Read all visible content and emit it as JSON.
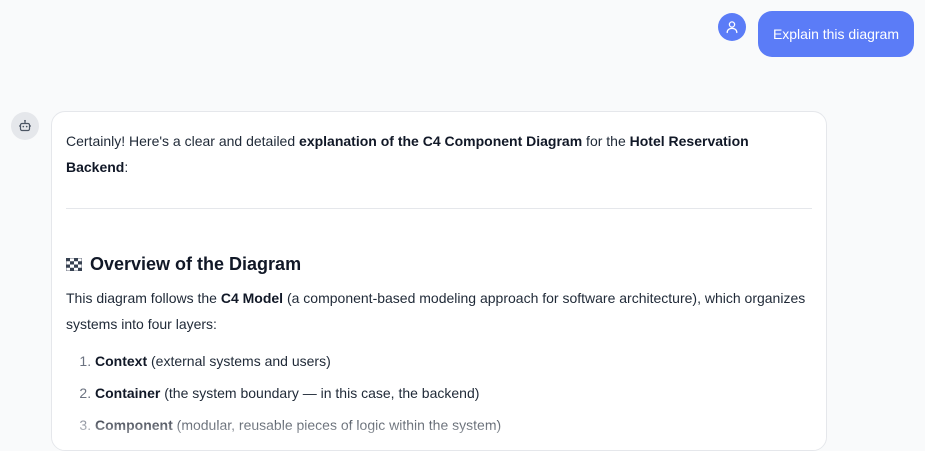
{
  "user_message": {
    "text": "Explain this diagram"
  },
  "assistant_message": {
    "intro_prefix": "Certainly! Here's a clear and detailed ",
    "intro_bold_1": "explanation of the C4 Component Diagram",
    "intro_mid": " for the ",
    "intro_bold_2": "Hotel Reservation Backend",
    "intro_suffix": ":",
    "heading": "Overview of the Diagram",
    "para_prefix": "This diagram follows the ",
    "para_bold": "C4 Model",
    "para_suffix": " (a component-based modeling approach for software architecture), which organizes systems into four layers:",
    "layers": [
      {
        "term": "Context",
        "desc": " (external systems and users)"
      },
      {
        "term": "Container",
        "desc": " (the system boundary — in this case, the backend)"
      },
      {
        "term": "Component",
        "desc": " (modular, reusable pieces of logic within the system)"
      }
    ]
  },
  "icons": {
    "user": "user-icon",
    "bot": "robot-icon",
    "heading": "checkered-flag-icon"
  },
  "colors": {
    "accent": "#5b7cf7",
    "background": "#f9fafb",
    "card_border": "#e5e7eb"
  }
}
